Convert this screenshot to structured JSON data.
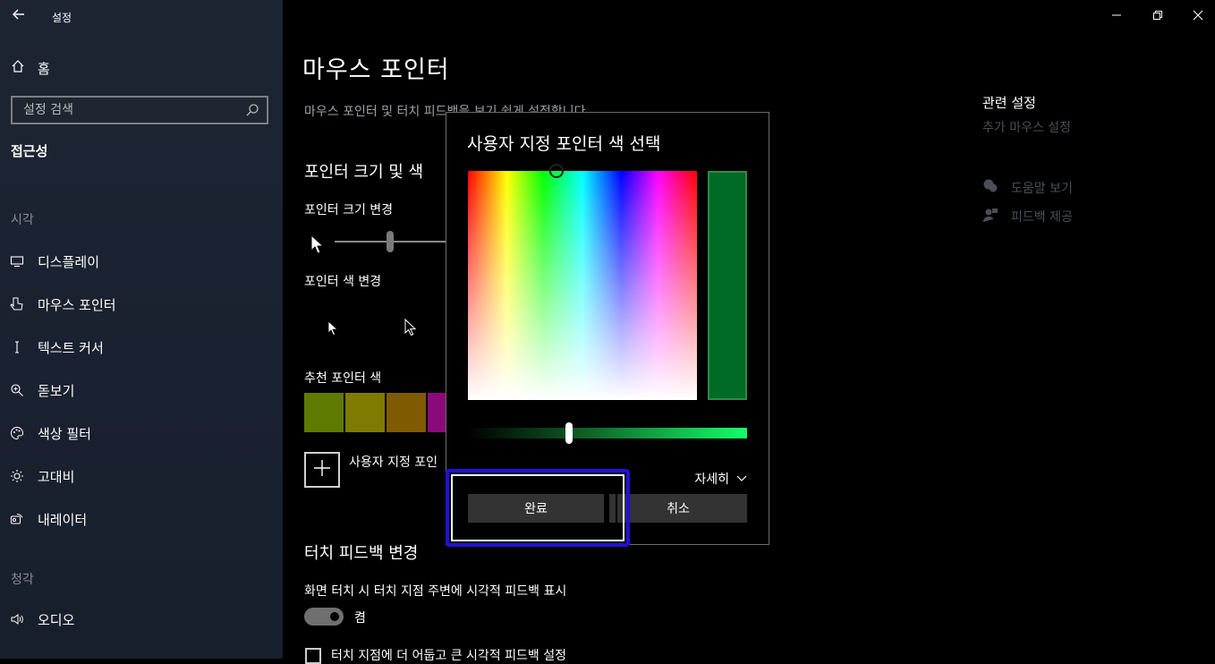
{
  "window": {
    "app_title": "설정",
    "back_icon": "back-arrow-icon",
    "controls": [
      "minimize-icon",
      "restore-icon",
      "close-icon"
    ]
  },
  "sidebar": {
    "home_label": "홈",
    "search_placeholder": "설정 검색",
    "section_title": "접근성",
    "group_vision": "시각",
    "group_hearing": "청각",
    "items": [
      {
        "label": "디스플레이",
        "icon": "monitor-icon"
      },
      {
        "label": "마우스 포인터",
        "icon": "pointer-hand-icon"
      },
      {
        "label": "텍스트 커서",
        "icon": "text-cursor-icon"
      },
      {
        "label": "돋보기",
        "icon": "magnifier-icon"
      },
      {
        "label": "색상 필터",
        "icon": "palette-icon"
      },
      {
        "label": "고대비",
        "icon": "brightness-icon"
      },
      {
        "label": "내레이터",
        "icon": "narrator-icon"
      },
      {
        "label": "오디오",
        "icon": "speaker-icon"
      }
    ]
  },
  "main": {
    "title": "마우스 포인터",
    "description": "마우스 포인터 및 터치 피드백을 보기 쉽게 설정합니다",
    "size_color_heading": "포인터 크기 및 색",
    "size_label": "포인터 크기 변경",
    "color_label": "포인터 색 변경",
    "suggested_label": "추천 포인터 색",
    "swatches": [
      "#5f7a00",
      "#7f7a00",
      "#7f5a00",
      "#8a0a7a"
    ],
    "custom_label": "사용자 지정 포인",
    "touch_heading": "터치 피드백 변경",
    "touch_desc": "화면 터치 시 터치 지점 주변에 시각적 피드백 표시",
    "toggle_state": "켬",
    "checkbox_label": "터치 지점에 더 어둡고 큰 시각적 피드백 설정"
  },
  "related": {
    "title": "관련 설정",
    "link": "추가 마우스 설정",
    "help": [
      {
        "label": "도움말 보기",
        "icon": "help-chat-icon"
      },
      {
        "label": "피드백 제공",
        "icon": "feedback-icon"
      }
    ]
  },
  "dialog": {
    "title": "사용자 지정 포인터 색 선택",
    "preview_color": "#006b25",
    "more_label": "자세히",
    "done_label": "완료",
    "cancel_label": "취소"
  }
}
